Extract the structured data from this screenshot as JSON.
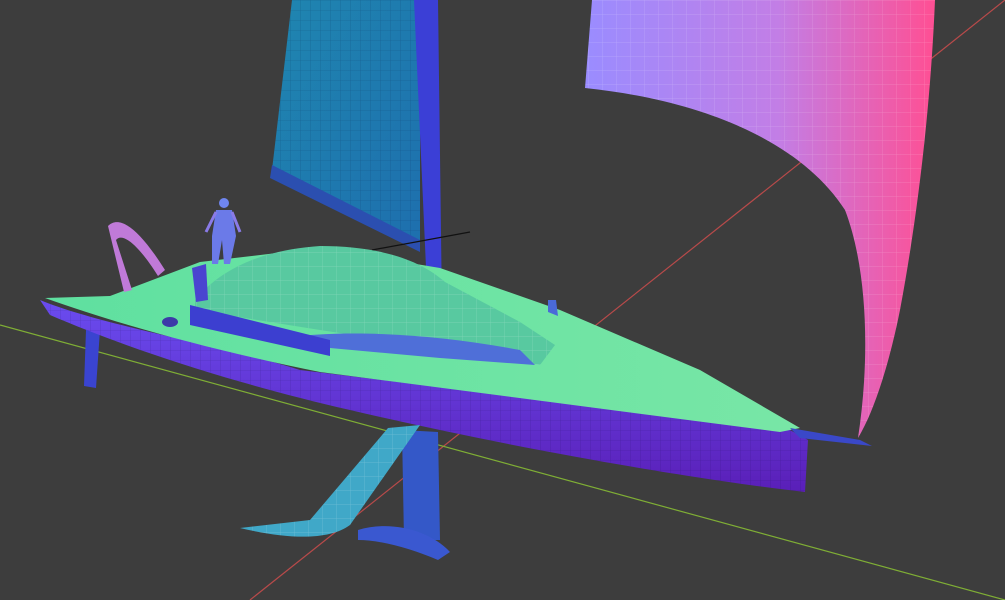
{
  "viewport": {
    "background": "#3d3d3d",
    "axis_x_color": "#d94a4a",
    "axis_y_color": "#8fbf3a"
  },
  "model": {
    "deck_color": "#6fe3a0",
    "hull_color": "#5a3cd6",
    "mainsail_color": "#1f78b4",
    "spinnaker_gradient": [
      "#8a78ff",
      "#ff5aa0"
    ],
    "foil_color": "#3fa0c8"
  }
}
